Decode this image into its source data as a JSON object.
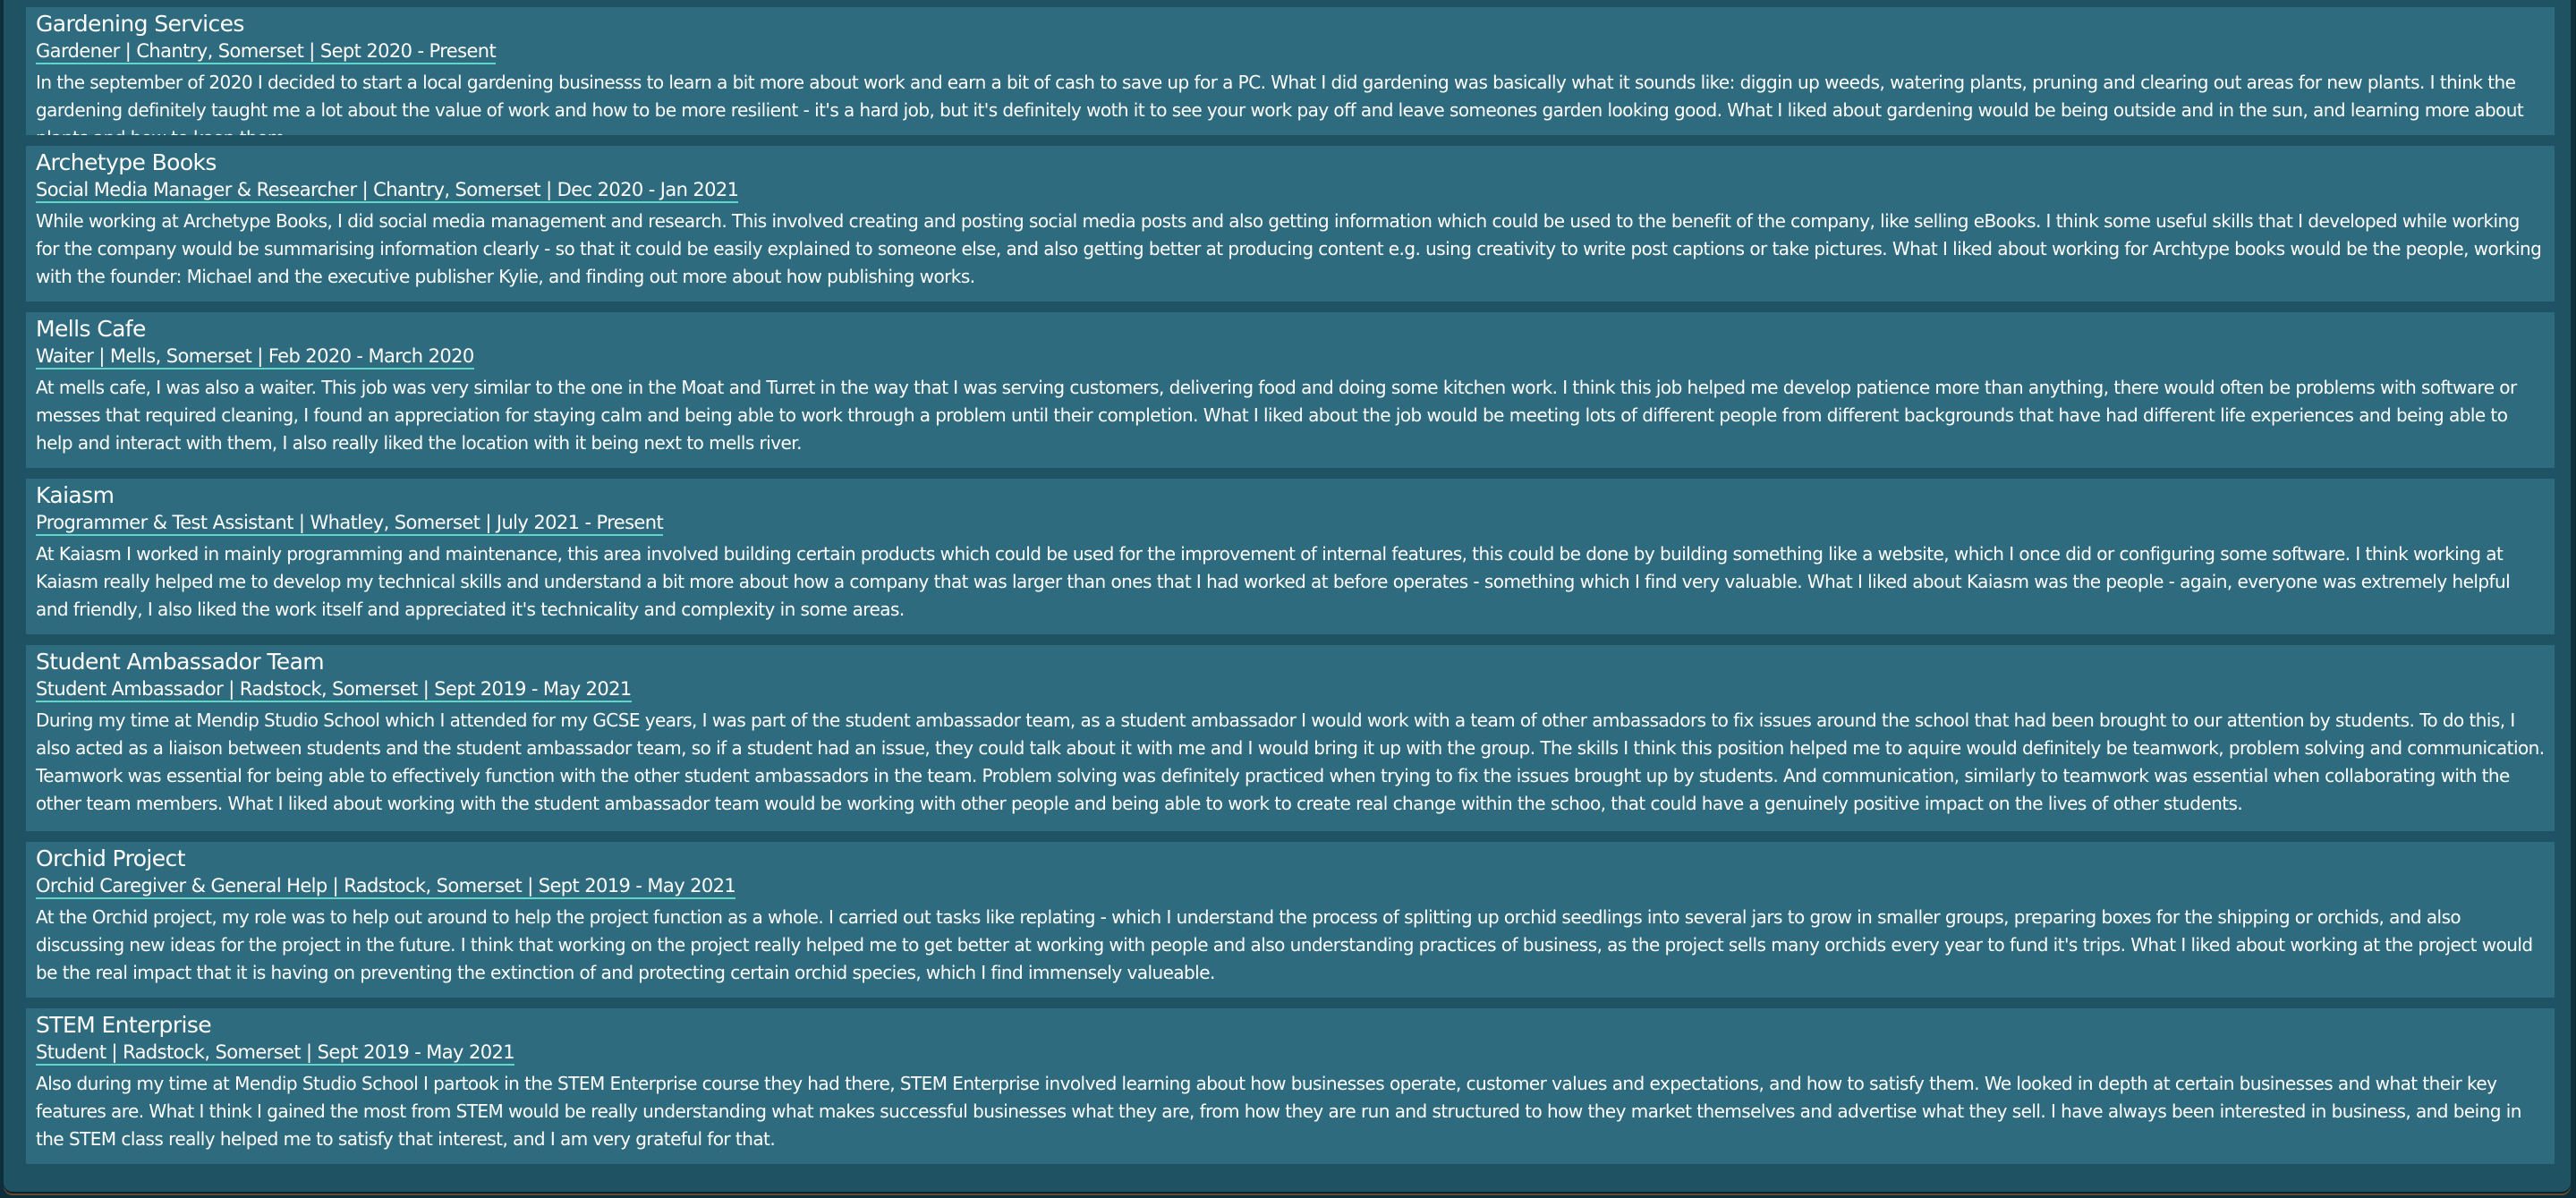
{
  "experience": [
    {
      "name": "Gardening Services",
      "role": "Gardener | Chantry, Somerset | Sept 2020 - Present",
      "description": "In the september of 2020 I decided to start a local gardening businesss to learn a bit more about work and earn a bit of cash to save up for a PC. What I did gardening was basically what it sounds like: diggin up weeds, watering plants, pruning and clearing out areas for new plants. I think the gardening definitely taught me a lot about the value of work and how to be more resilient - it's a hard job, but it's definitely woth it to see your work pay off and leave someones garden looking good. What I liked about gardening would be being outside and in the sun, and learning more about plants and how to keep them."
    },
    {
      "name": "Archetype Books",
      "role": "Social Media Manager & Researcher | Chantry, Somerset | Dec 2020 - Jan 2021",
      "description": "While working at Archetype Books, I did social media management and research. This involved creating and posting social media posts and also getting information which could be used to the benefit of the company, like selling eBooks. I think some useful skills that I developed while working for the company would be summarising information clearly - so that it could be easily explained to someone else, and also getting better at producing content e.g. using creativity to write post captions or take pictures. What I liked about working for Archtype books would be the people, working with the founder: Michael and the executive publisher Kylie, and finding out more about how publishing works."
    },
    {
      "name": "Mells Cafe",
      "role": "Waiter | Mells, Somerset | Feb 2020 - March 2020",
      "description": "At mells cafe, I was also a waiter. This job was very similar to the one in the Moat and Turret in the way that I was serving customers, delivering food and doing some kitchen work. I think this job helped me develop patience more than anything, there would often be problems with software or messes that required cleaning, I found an appreciation for staying calm and being able to work through a problem until their completion. What I liked about the job would be meeting lots of different people from different backgrounds that have had different life experiences and being able to help and interact with them, I also really liked the location with it being next to mells river."
    },
    {
      "name": "Kaiasm",
      "role": "Programmer & Test Assistant | Whatley, Somerset | July 2021 - Present",
      "description": "At Kaiasm I worked in mainly programming and maintenance, this area involved building certain products which could be used for the improvement of internal features, this could be done by building something like a website, which I once did or configuring some software. I think working at Kaiasm really helped me to develop my technical skills and understand a bit more about how a company that was larger than ones that I had worked at before operates - something which I find very valuable. What I liked about Kaiasm was the people - again, everyone was extremely helpful and friendly, I also liked the work itself and appreciated it's technicality and complexity in some areas."
    },
    {
      "name": "Student Ambassador Team",
      "role": "Student Ambassador | Radstock, Somerset | Sept 2019 - May 2021",
      "description": "During my time at Mendip Studio School which I attended for my GCSE years, I was part of the student ambassador team, as a student ambassador I would work with a team of other ambassadors to fix issues around the school that had been brought to our attention by students. To do this, I also acted as a liaison between students and the student ambassador team, so if a student had an issue, they could talk about it with me and I would bring it up with the group. The skills I think this position helped me to aquire would definitely be teamwork, problem solving and communication. Teamwork was essential for being able to effectively function with the other student ambassadors in the team. Problem solving was definitely practiced when trying to fix the issues brought up by students. And communication, similarly to teamwork was essential when collaborating with the other team members. What I liked about working with the student ambassador team would be working with other people and being able to work to create real change within the schoo, that could have a genuinely positive impact on the lives of other students."
    },
    {
      "name": "Orchid Project",
      "role": "Orchid Caregiver & General Help | Radstock, Somerset | Sept 2019 - May 2021",
      "description": "At the Orchid project, my role was to help out around to help the project function as a whole. I carried out tasks like replating - which I understand the process of splitting up orchid seedlings into several jars to grow in smaller groups, preparing boxes for the shipping or orchids, and also discussing new ideas for the project in the future. I think that working on the project really helped me to get better at working with people and also understanding practices of business, as the project sells many orchids every year to fund it's trips. What I liked about working at the project would be the real impact that it is having on preventing the extinction of and protecting certain orchid species, which I find immensely valueable."
    },
    {
      "name": "STEM Enterprise",
      "role": "Student | Radstock, Somerset | Sept 2019 - May 2021",
      "description": "Also during my time at Mendip Studio School I partook in the STEM Enterprise course they had there, STEM Enterprise involved learning about how businesses operate, customer values and expectations, and how to satisfy them. We looked in depth at certain businesses and what their key features are. What I think I gained the most from STEM would be really understanding what makes successful businesses what they are, from how they are run and structured to how they market themselves and advertise what they sell. I have always been interested in business, and being in the STEM class really helped me to satisfy that interest, and I am very grateful for that."
    }
  ]
}
